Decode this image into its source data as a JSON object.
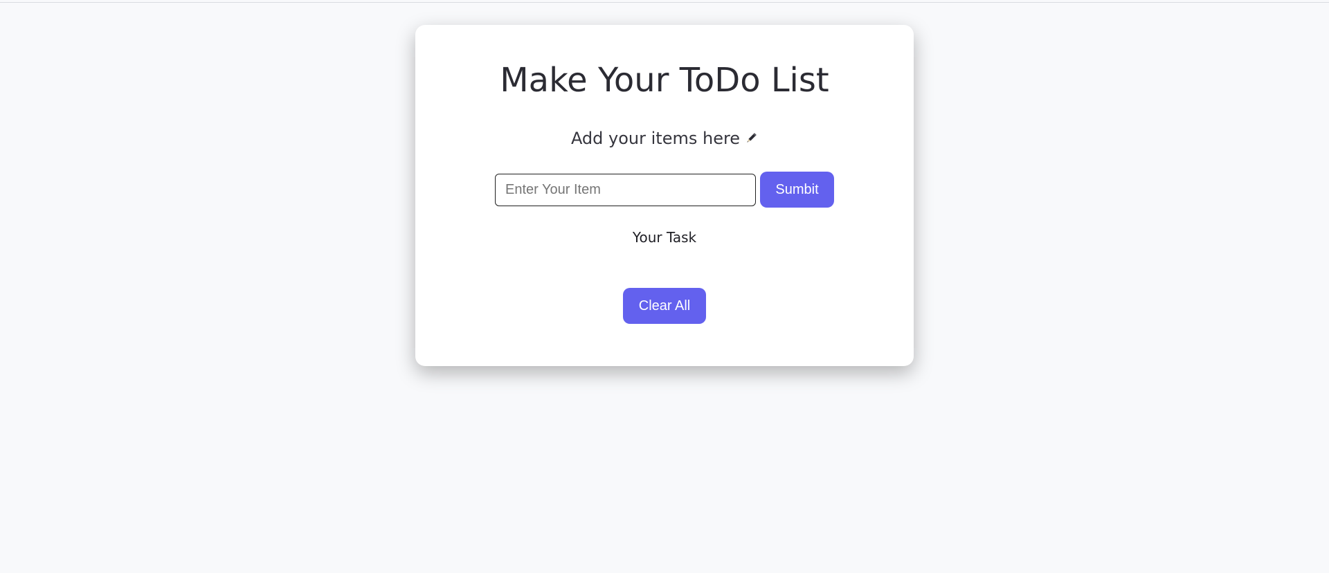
{
  "page": {
    "title": "Make Your ToDo List",
    "subtitle": "Add your items here",
    "subtitle_icon": "pencil-icon"
  },
  "form": {
    "input_value": "",
    "input_placeholder": "Enter Your Item",
    "submit_label": "Sumbit"
  },
  "tasks": {
    "heading": "Your Task",
    "items": []
  },
  "actions": {
    "clear_label": "Clear All"
  },
  "colors": {
    "accent": "#6361ee",
    "background": "#f8f9fb",
    "card": "#ffffff",
    "text": "#2b2b33"
  }
}
